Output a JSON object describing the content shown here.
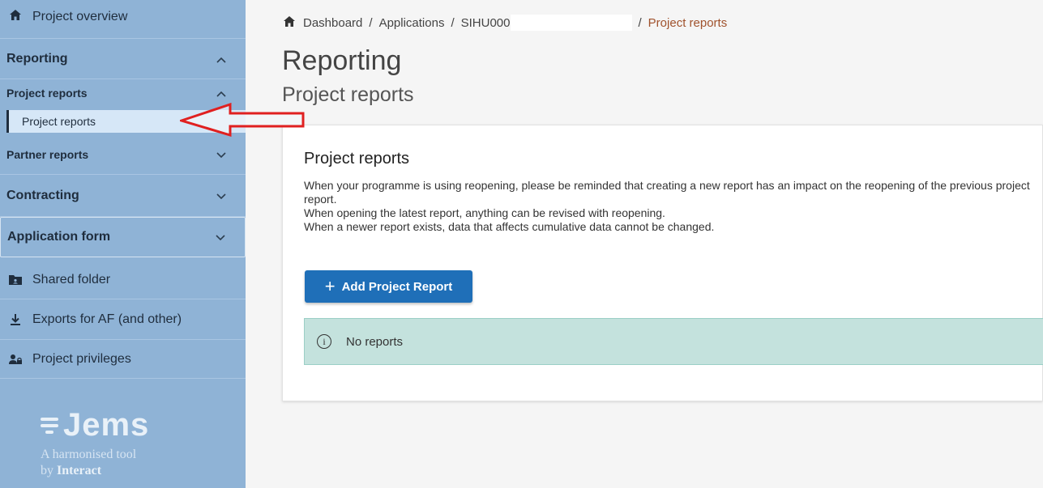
{
  "sidebar": {
    "overview": "Project overview",
    "reporting": "Reporting",
    "project_reports_group": "Project reports",
    "project_reports_item": "Project reports",
    "partner_reports": "Partner reports",
    "contracting": "Contracting",
    "application_form": "Application form",
    "shared_folder": "Shared folder",
    "exports": "Exports for AF (and other)",
    "privileges": "Project privileges",
    "logo_name": "Jems",
    "logo_tagline": "A harmonised tool",
    "logo_by": "by ",
    "logo_org": "Interact"
  },
  "breadcrumb": {
    "dashboard": "Dashboard",
    "applications": "Applications",
    "application_id": "SIHU000",
    "current": "Project reports",
    "separator": "/"
  },
  "header": {
    "title": "Reporting",
    "subtitle": "Project reports"
  },
  "card": {
    "title": "Project reports",
    "line1": "When your programme is using reopening, please be reminded that creating a new report has an impact on the reopening of the previous project report.",
    "line2": "When opening the latest report, anything can be revised with reopening.",
    "line3": "When a newer report exists, data that affects cumulative data cannot be changed.",
    "add_button": "Add Project Report",
    "empty_message": "No reports"
  },
  "icons": {
    "home": "home-icon",
    "chevron_up": "chevron-up-icon",
    "chevron_down": "chevron-down-icon",
    "folder": "folder-icon",
    "download": "download-icon",
    "users": "users-lock-icon",
    "info": "info-icon",
    "plus": "plus-icon",
    "arrow": "red-arrow-annotation"
  },
  "colors": {
    "sidebar_bg": "#8fb3d6",
    "active_item_bg": "#d6e7f7",
    "primary_button": "#1f6fb8",
    "info_box": "#c4e2dd",
    "breadcrumb_current": "#a0522d",
    "arrow": "#e02020"
  }
}
